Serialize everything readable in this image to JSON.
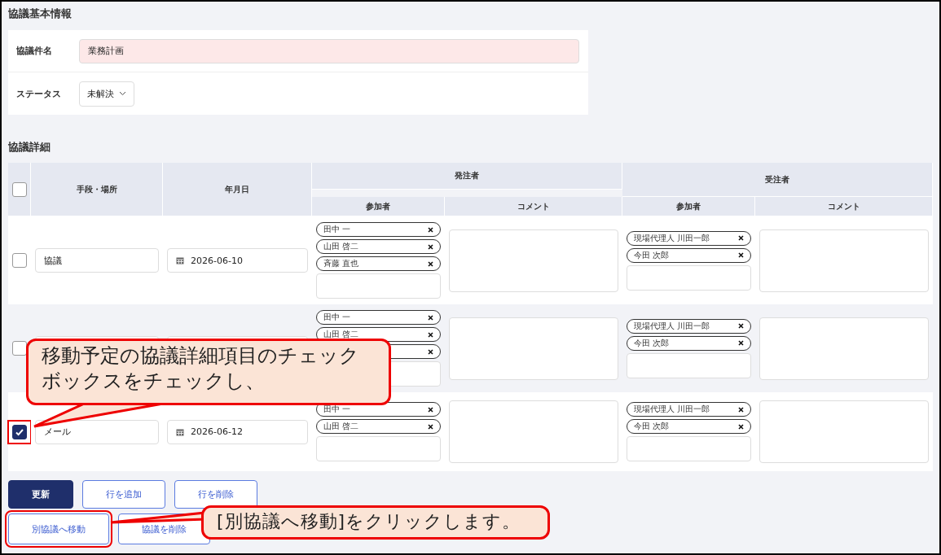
{
  "info": {
    "title": "協議基本情報",
    "fields": [
      {
        "label": "協議件名",
        "kind": "text",
        "value": "業務計画",
        "invalid": true
      },
      {
        "label": "ステータス",
        "kind": "select",
        "value": "未解決"
      }
    ]
  },
  "details": {
    "title": "協議詳細",
    "select_all": {
      "checked": false
    },
    "columns": [
      {
        "label": "手段・場所"
      },
      {
        "label": "年月日"
      },
      {
        "label": "発注者",
        "children": [
          {
            "label": "参加者"
          },
          {
            "label": "コメント"
          }
        ]
      },
      {
        "label": "受注者",
        "children": [
          {
            "label": "参加者"
          },
          {
            "label": "コメント"
          }
        ]
      }
    ],
    "rows": [
      {
        "checked": false,
        "hovered": false,
        "highlighted": false,
        "method": "協議",
        "date": "2026-06-10",
        "orderer": [
          {
            "kind": "named",
            "label": "田中 一"
          },
          {
            "kind": "named",
            "label": "山田 啓二"
          },
          {
            "kind": "named",
            "label": "斉藤 直也"
          }
        ],
        "contractor": [
          {
            "kind": "named",
            "label": "現場代理人 川田一郎"
          },
          {
            "kind": "named",
            "label": "今田 次郎"
          }
        ]
      },
      {
        "checked": false,
        "hovered": true,
        "highlighted": false,
        "orderer": [
          {
            "kind": "named",
            "label": "田中 一"
          },
          {
            "kind": "named",
            "label": "山田 啓二"
          },
          {
            "kind": "covered"
          }
        ],
        "contractor": [
          {
            "kind": "named",
            "label": "現場代理人 川田一郎"
          },
          {
            "kind": "named",
            "label": "今田 次郎"
          }
        ]
      },
      {
        "checked": true,
        "hovered": false,
        "highlighted": true,
        "method": "メール",
        "date": "2026-06-12",
        "orderer": [
          {
            "kind": "named",
            "label": "田中 一"
          },
          {
            "kind": "named",
            "label": "山田 啓二"
          }
        ],
        "contractor": [
          {
            "kind": "named",
            "label": "現場代理人 川田一郎"
          },
          {
            "kind": "named",
            "label": "今田 次郎"
          }
        ]
      }
    ]
  },
  "buttons": [
    [
      {
        "label": "更新",
        "kind": "primary",
        "highlighted": false
      },
      {
        "label": "行を追加",
        "kind": "outline",
        "highlighted": false
      },
      {
        "label": "行を削除",
        "kind": "outline",
        "highlighted": false
      }
    ],
    [
      {
        "label": "別協議へ移動",
        "kind": "outline",
        "highlighted": true
      },
      {
        "label": "協議を削除",
        "kind": "outline",
        "highlighted": false
      }
    ]
  ],
  "callouts": [
    {
      "text": "移動予定の協議詳細項目のチェックボックスをチェックし、",
      "kind": "row"
    },
    {
      "text": "[別協議へ移動]をクリックします。",
      "kind": "button"
    }
  ]
}
